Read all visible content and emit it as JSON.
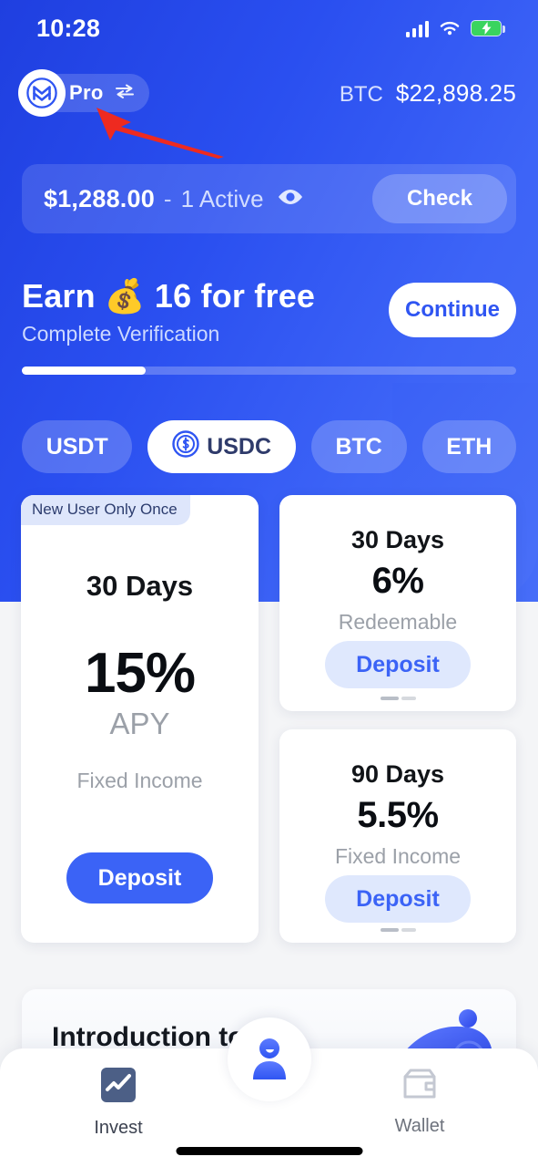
{
  "status_bar": {
    "time": "10:28",
    "signal_icon": "cellular-signal-icon",
    "wifi_icon": "wifi-icon",
    "battery_icon": "battery-charging-icon"
  },
  "header": {
    "logo_icon": "app-logo-icon",
    "pro_label": "Pro",
    "swap_icon": "swap-arrows-icon",
    "ticker_symbol": "BTC",
    "ticker_price": "$22,898.25"
  },
  "annotation": {
    "arrow_icon": "red-arrow-pointer",
    "color": "#ee2a20"
  },
  "balance_card": {
    "amount": "$1,288.00",
    "separator": "-",
    "active_text": "1 Active",
    "eye_icon": "eye-icon",
    "check_label": "Check"
  },
  "earn_banner": {
    "title_prefix": "Earn",
    "money_bag_icon": "💰",
    "title_suffix": "16 for free",
    "subtitle": "Complete Verification",
    "continue_label": "Continue",
    "progress_percent": 25
  },
  "currency_tabs": [
    {
      "label": "USDT",
      "active": false,
      "icon": null
    },
    {
      "label": "USDC",
      "active": true,
      "icon": "usdc-coin-icon"
    },
    {
      "label": "BTC",
      "active": false,
      "icon": null
    },
    {
      "label": "ETH",
      "active": false,
      "icon": null
    }
  ],
  "featured_card": {
    "badge": "New User Only Once",
    "term": "30 Days",
    "rate": "15%",
    "rate_unit": "APY",
    "income_type": "Fixed Income",
    "deposit_label": "Deposit"
  },
  "side_cards": [
    {
      "term": "30 Days",
      "rate": "6%",
      "income_type": "Redeemable",
      "deposit_label": "Deposit",
      "pagination": {
        "active": 1,
        "total": 2
      }
    },
    {
      "term": "90 Days",
      "rate": "5.5%",
      "income_type": "Fixed Income",
      "deposit_label": "Deposit",
      "pagination": {
        "active": 1,
        "total": 2
      }
    }
  ],
  "intro_card": {
    "title": "Introduction to Lite",
    "art_icon": "blue-blob-illustration"
  },
  "tab_bar": {
    "invest": {
      "label": "Invest",
      "icon": "chart-invest-icon",
      "active": true
    },
    "center": {
      "icon": "profile-person-icon"
    },
    "wallet": {
      "label": "Wallet",
      "icon": "wallet-icon",
      "active": false
    }
  },
  "colors": {
    "brand_blue": "#2f55f2",
    "hero_gradient_start": "#1f3fe0",
    "hero_gradient_end": "#466df8",
    "deposit_primary": "#3b63f6",
    "deposit_soft_bg": "#dfe8fd",
    "badge_bg": "#dee6fb",
    "badge_text": "#2c3c6e",
    "muted_text": "#9ba0a8",
    "annotation_red": "#ee2a20",
    "battery_green": "#3ad45e"
  }
}
